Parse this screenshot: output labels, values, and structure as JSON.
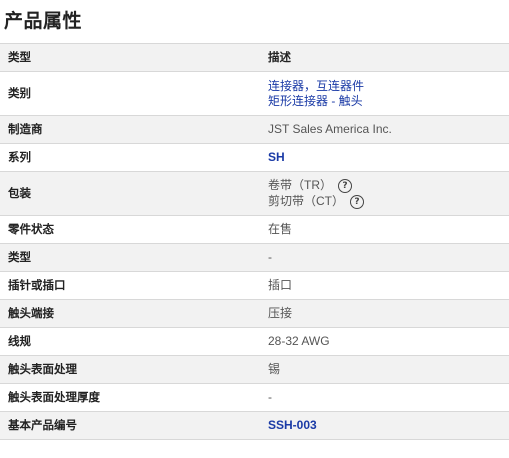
{
  "title": "产品属性",
  "header": {
    "type": "类型",
    "description": "描述"
  },
  "rows": {
    "category": {
      "label": "类别",
      "values": [
        "连接器，互连器件",
        "矩形连接器 - 触头"
      ]
    },
    "manufacturer": {
      "label": "制造商",
      "value": "JST Sales America Inc."
    },
    "series": {
      "label": "系列",
      "value": "SH"
    },
    "packaging": {
      "label": "包装",
      "values": [
        "卷带（TR）",
        "剪切带（CT）"
      ],
      "help_icon": "help-circle-icon"
    },
    "part_status": {
      "label": "零件状态",
      "value": "在售"
    },
    "type": {
      "label": "类型",
      "value": "-"
    },
    "pin_or_socket": {
      "label": "插针或插口",
      "value": "插口"
    },
    "contact_termination": {
      "label": "触头端接",
      "value": "压接"
    },
    "wire_gauge": {
      "label": "线规",
      "value": "28-32 AWG"
    },
    "contact_finish": {
      "label": "触头表面处理",
      "value": "锡"
    },
    "contact_finish_thickness": {
      "label": "触头表面处理厚度",
      "value": "-"
    },
    "base_part_number": {
      "label": "基本产品编号",
      "value": "SSH-003"
    }
  },
  "colors": {
    "link": "#1a3aa6",
    "row_alt": "#f2f2f2",
    "border": "#d8d8d8"
  }
}
